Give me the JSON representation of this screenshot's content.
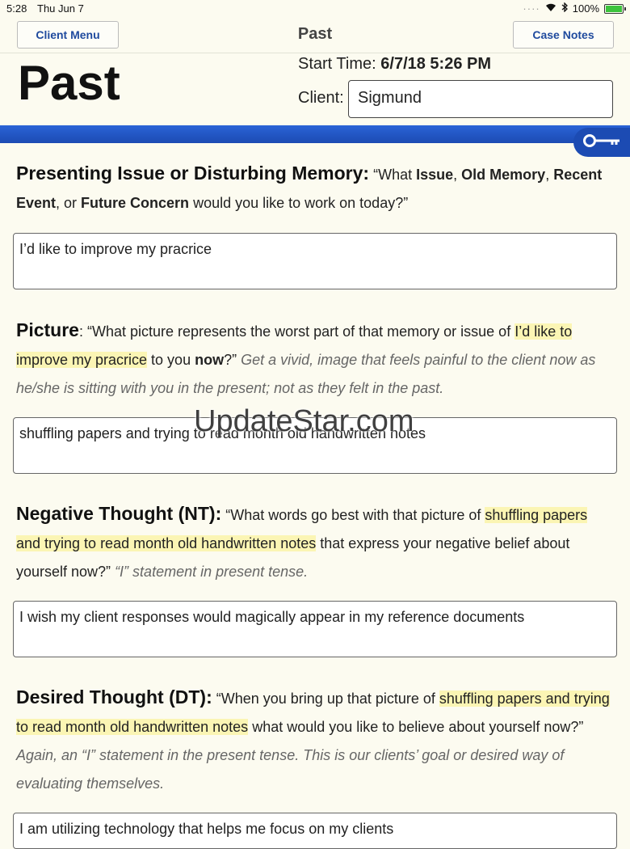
{
  "status_bar": {
    "time": "5:28",
    "date": "Thu Jun 7",
    "battery": "100%",
    "battery_level": 1.0
  },
  "nav": {
    "left_button": "Client Menu",
    "title": "Past",
    "right_button": "Case Notes"
  },
  "page_title": "Past",
  "start_time": {
    "label": "Start Time:",
    "value": "6/7/18 5:26 PM"
  },
  "client": {
    "label": "Client:",
    "value": "Sigmund"
  },
  "icons": {
    "key": "key-icon",
    "wifi": "wifi-icon",
    "bluetooth": "bluetooth-icon"
  },
  "colors": {
    "accent_blue": "#1c4bb3",
    "highlight": "#fbf5b4",
    "background": "#fcfbf0"
  },
  "sections": [
    {
      "heading": "Presenting Issue or Disturbing Memory:",
      "q1": " “What ",
      "b1": "Issue",
      "q2": ", ",
      "b2": "Old Memory",
      "q3": ", ",
      "b3": "Recent Event",
      "q4": ", or ",
      "b4": "Future Concern",
      "q5": " would you like to work on today?”",
      "answer": "I’d like to improve my pracrice"
    },
    {
      "heading": "Picture",
      "q1": ": “What picture represents the worst part of that memory or issue of ",
      "hl": "I’d like to improve my pracrice",
      "q2": " to you ",
      "b1": "now",
      "q3": "?” ",
      "note": "Get a vivid, image that feels painful to the client now as he/she is sitting with you in the present; not as they felt in the past.",
      "answer": "shuffling papers and trying to read month old handwritten notes"
    },
    {
      "heading": "Negative Thought (NT):",
      "q1": " “What words go best with that picture of ",
      "hl": "shuffling papers and trying to read month old handwritten notes",
      "q2": " that express your negative belief about yourself now?” ",
      "note": "“I” statement in present tense.",
      "answer": "I wish my client responses would magically appear in my reference documents"
    },
    {
      "heading": "Desired Thought (DT):",
      "q1": " “When you bring up that picture of ",
      "hl": "shuffling papers and trying to read month old handwritten notes",
      "q2": " what would you like to believe about yourself now?” ",
      "note": "Again, an “I” statement in the present tense. This is our clients’ goal or desired way of evaluating themselves.",
      "answer": "I am utilizing technology that helps me focus on my clients"
    }
  ],
  "watermark": "UpdateStar.com"
}
